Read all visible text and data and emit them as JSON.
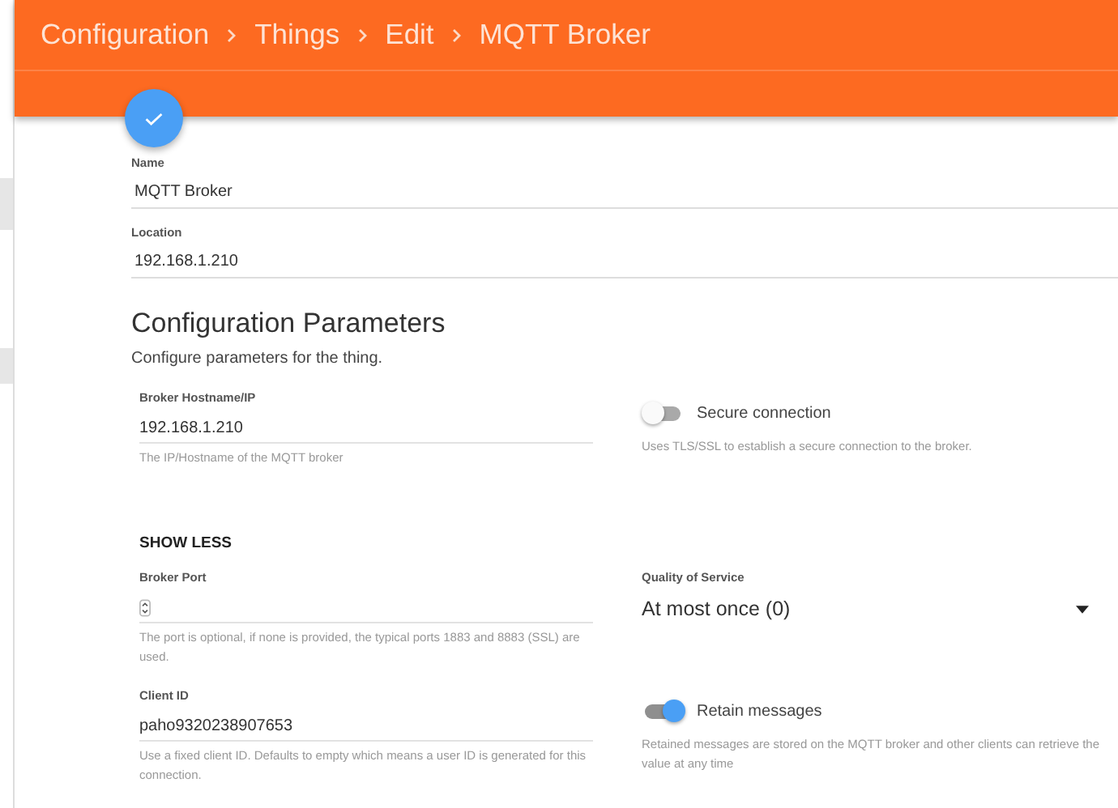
{
  "breadcrumb": [
    "Configuration",
    "Things",
    "Edit",
    "MQTT Broker"
  ],
  "thing_fields": [
    {
      "label": "Name",
      "value": "MQTT Broker"
    },
    {
      "label": "Location",
      "value": "192.168.1.210"
    }
  ],
  "section": {
    "title": "Configuration Parameters",
    "subtitle": "Configure parameters for the thing."
  },
  "parameters": [
    {
      "kind": "text",
      "label": "Broker Hostname/IP",
      "value": "192.168.1.210",
      "help": "The IP/Hostname of the MQTT broker"
    },
    {
      "kind": "toggle",
      "label": "Secure connection",
      "on": false,
      "help": "Uses TLS/SSL to establish a secure connection to the broker."
    },
    {
      "kind": "more",
      "label": "SHOW LESS"
    },
    {
      "kind": "number",
      "label": "Broker Port",
      "help": "The port is optional, if none is provided, the typical ports 1883 and 8883 (SSL) are used."
    },
    {
      "kind": "select",
      "label": "Quality of Service",
      "value": "At most once (0)"
    },
    {
      "kind": "text",
      "label": "Client ID",
      "value": "paho9320238907653",
      "help": "Use a fixed client ID. Defaults to empty which means a user ID is generated for this connection."
    },
    {
      "kind": "toggle",
      "label": "Retain messages",
      "on": true,
      "help": "Retained messages are stored on the MQTT broker and other clients can retrieve the value at any time"
    }
  ]
}
